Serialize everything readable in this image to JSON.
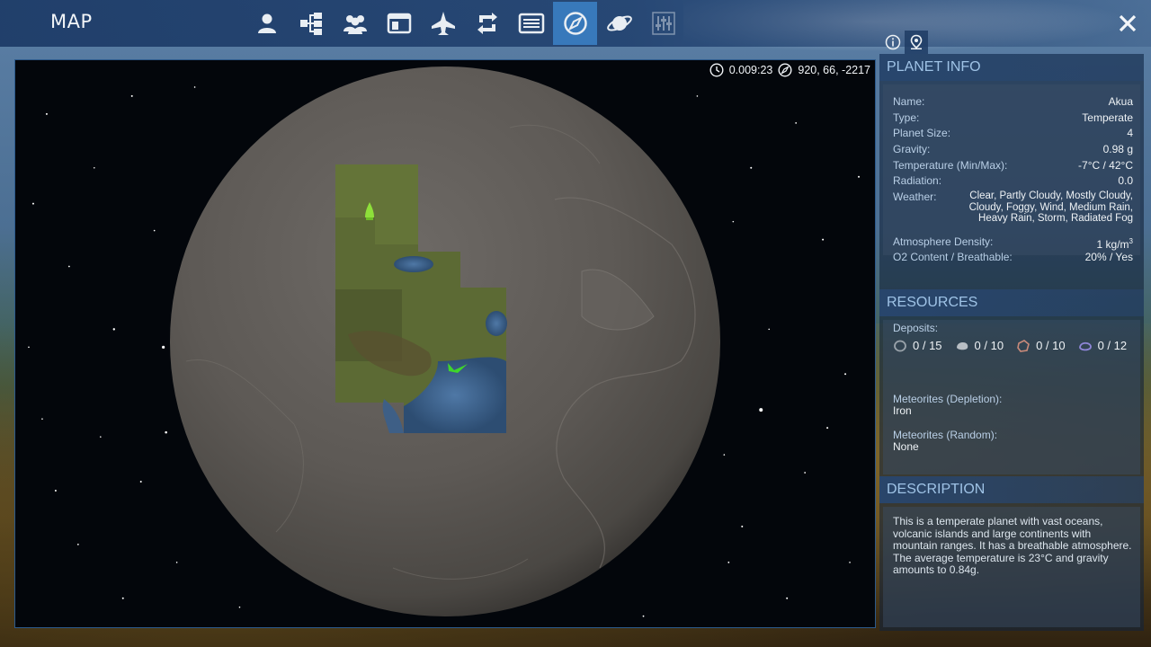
{
  "header": {
    "title": "MAP",
    "tabs": [
      {
        "icon": "person-icon",
        "active": false
      },
      {
        "icon": "hierarchy-icon",
        "active": false
      },
      {
        "icon": "group-icon",
        "active": false
      },
      {
        "icon": "window-icon",
        "active": false
      },
      {
        "icon": "spaceship-icon",
        "active": false
      },
      {
        "icon": "trade-icon",
        "active": false
      },
      {
        "icon": "list-icon",
        "active": false
      },
      {
        "icon": "compass-icon",
        "active": true
      },
      {
        "icon": "planet-icon",
        "active": false
      },
      {
        "icon": "sliders-icon",
        "active": false
      }
    ],
    "close_icon": "close-icon"
  },
  "hud": {
    "time": "0.009:23",
    "coordinates": "920, 66, -2217"
  },
  "planet_info": {
    "heading": "PLANET INFO",
    "rows": [
      {
        "label": "Name:",
        "value": "Akua"
      },
      {
        "label": "Type:",
        "value": "Temperate"
      },
      {
        "label": "Planet Size:",
        "value": "4"
      },
      {
        "label": "Gravity:",
        "value": "0.98 g"
      },
      {
        "label": "Temperature (Min/Max):",
        "value": "-7°C / 42°C"
      },
      {
        "label": "Radiation:",
        "value": "0.0"
      }
    ],
    "weather_label": "Weather:",
    "weather_value": "Clear, Partly Cloudy, Mostly Cloudy, Cloudy, Foggy, Wind, Medium Rain, Heavy Rain, Storm, Radiated Fog",
    "atmosphere_label": "Atmosphere Density:",
    "atmosphere_value": "1 kg/m",
    "atmosphere_unit_sup": "3",
    "o2_label": "O2 Content / Breathable:",
    "o2_value": "20% / Yes"
  },
  "resources": {
    "heading": "RESOURCES",
    "deposits_label": "Deposits:",
    "deposits": [
      {
        "icon": "ring-ore-icon",
        "value": "0 / 15",
        "color": "#9aa3ab"
      },
      {
        "icon": "rock-ore-icon",
        "value": "0 / 10",
        "color": "#b8bec4"
      },
      {
        "icon": "crystal-ore-icon",
        "value": "0 / 10",
        "color": "#c98a7a"
      },
      {
        "icon": "gem-ore-icon",
        "value": "0 / 12",
        "color": "#8f86d8"
      }
    ],
    "meteorites_depletion_label": "Meteorites (Depletion):",
    "meteorites_depletion_value": "Iron",
    "meteorites_random_label": "Meteorites (Random):",
    "meteorites_random_value": "None"
  },
  "description": {
    "heading": "DESCRIPTION",
    "text": "This is a temperate planet with vast oceans, volcanic islands and large continents with mountain ranges. It has a breathable atmosphere. The average temperature is 23°C and gravity amounts to 0.84g."
  },
  "colors": {
    "accent": "#3c82c8",
    "panel_heading": "#9fc3e6",
    "ship_marker": "#8ee03a",
    "base_marker": "#3fd62a"
  }
}
